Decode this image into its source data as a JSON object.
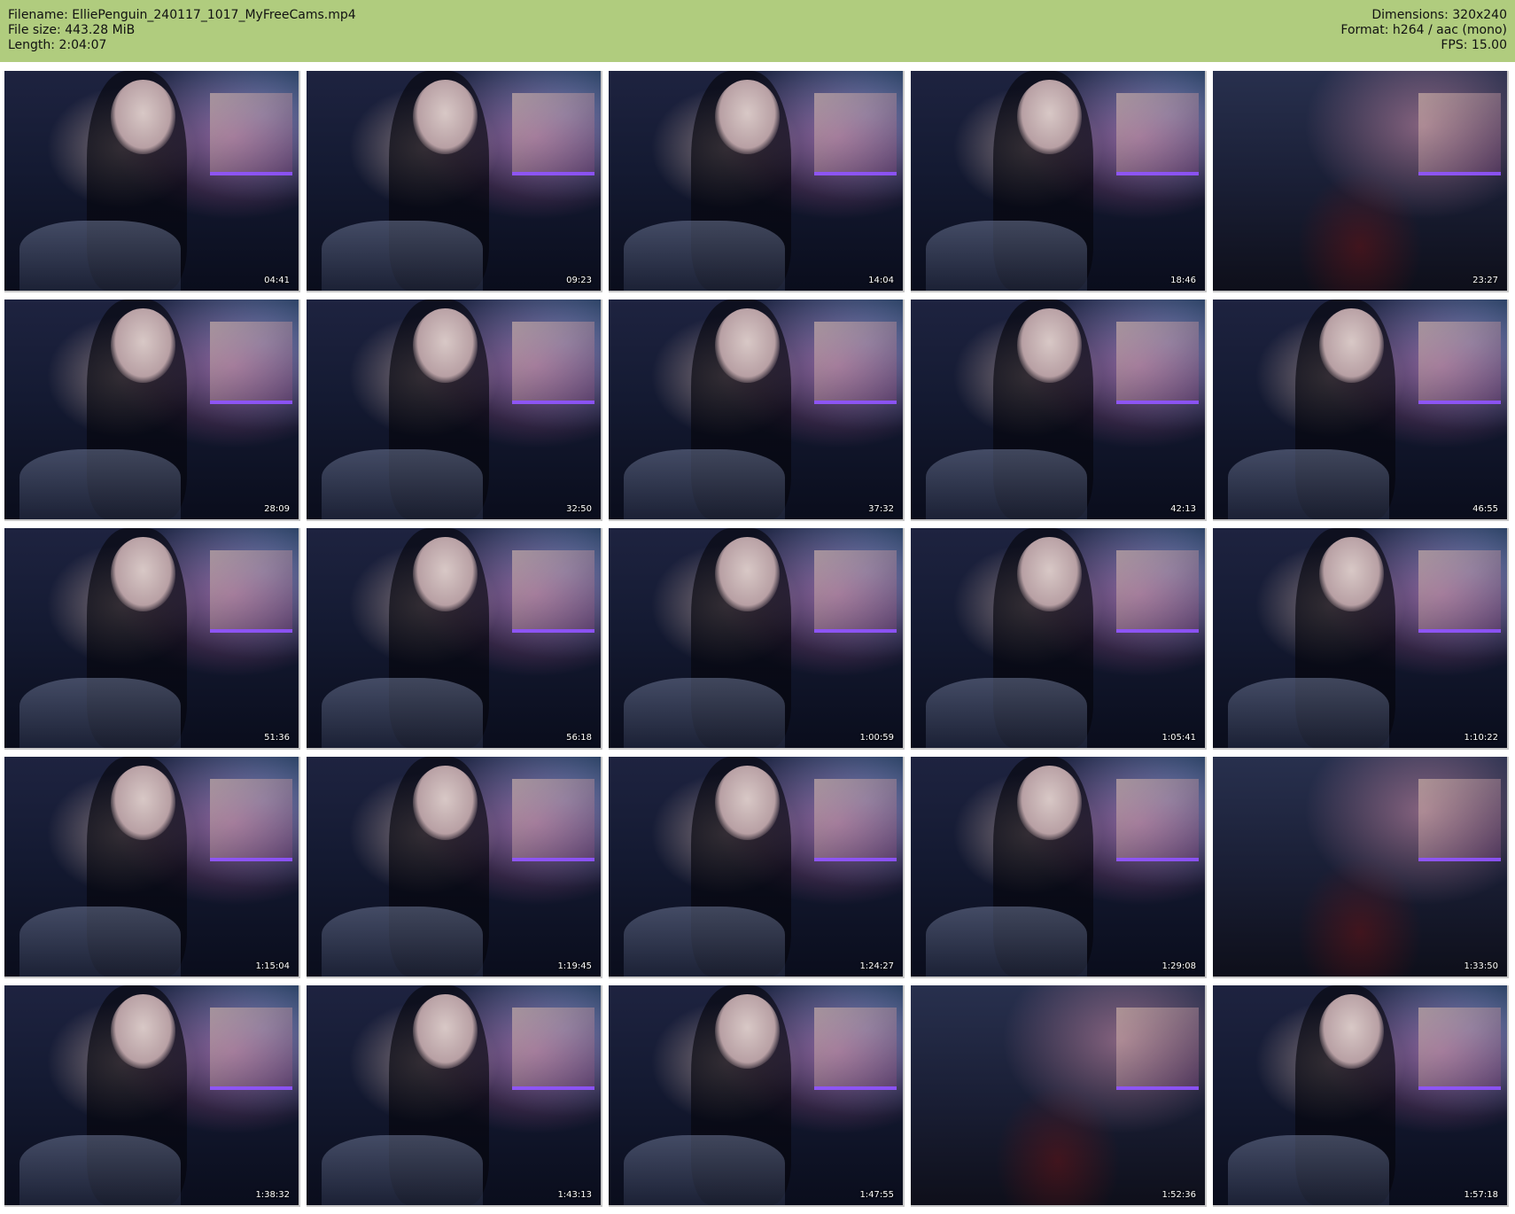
{
  "header": {
    "filename": "Filename: ElliePenguin_240117_1017_MyFreeCams.mp4",
    "filesize": "File size: 443.28 MiB",
    "length": "Length: 2:04:07",
    "dimensions": "Dimensions: 320x240",
    "format": "Format: h264 / aac (mono)",
    "fps": "FPS: 15.00"
  },
  "thumbnails": [
    {
      "time": "04:41"
    },
    {
      "time": "09:23"
    },
    {
      "time": "14:04"
    },
    {
      "time": "18:46"
    },
    {
      "time": "23:27",
      "empty": true
    },
    {
      "time": "28:09"
    },
    {
      "time": "32:50"
    },
    {
      "time": "37:32"
    },
    {
      "time": "42:13"
    },
    {
      "time": "46:55"
    },
    {
      "time": "51:36"
    },
    {
      "time": "56:18"
    },
    {
      "time": "1:00:59"
    },
    {
      "time": "1:05:41"
    },
    {
      "time": "1:10:22"
    },
    {
      "time": "1:15:04"
    },
    {
      "time": "1:19:45"
    },
    {
      "time": "1:24:27"
    },
    {
      "time": "1:29:08"
    },
    {
      "time": "1:33:50",
      "empty": true
    },
    {
      "time": "1:38:32"
    },
    {
      "time": "1:43:13"
    },
    {
      "time": "1:47:55"
    },
    {
      "time": "1:52:36",
      "empty": true
    },
    {
      "time": "1:57:18"
    }
  ]
}
